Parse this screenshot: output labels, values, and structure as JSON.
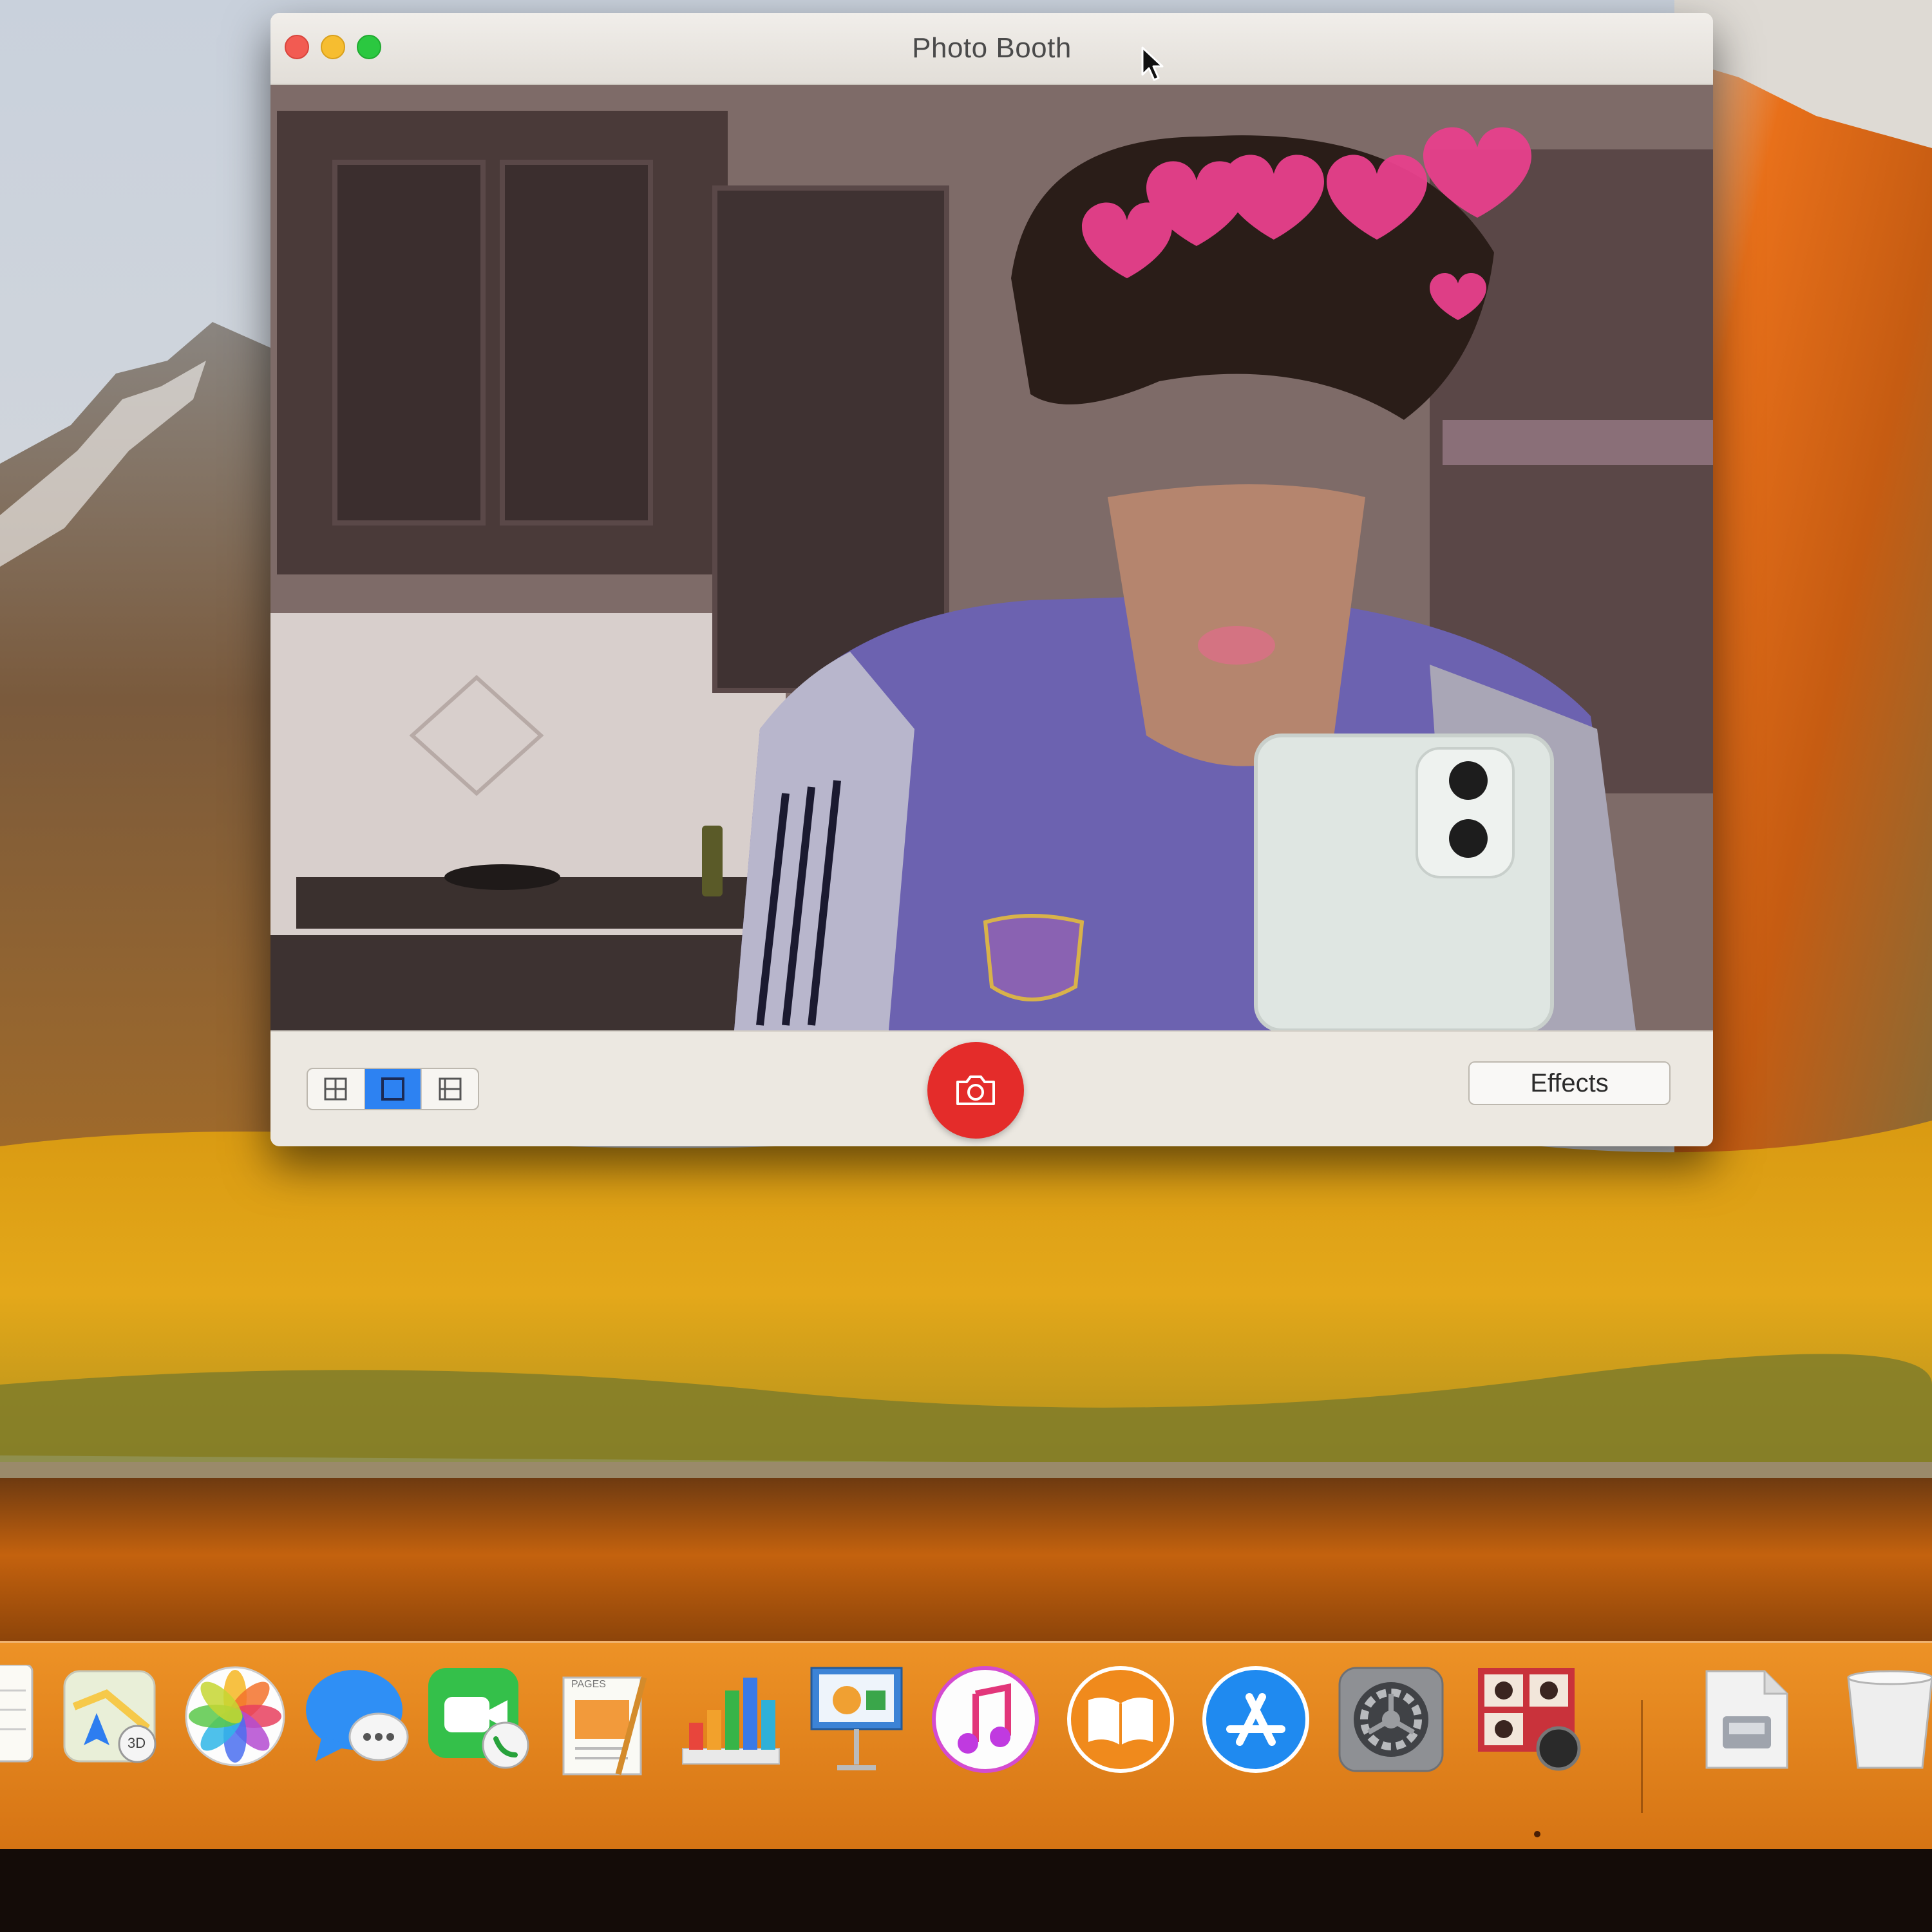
{
  "window": {
    "title": "Photo Booth"
  },
  "toolbar": {
    "layouts": [
      {
        "name": "four-up",
        "icon": "grid-icon",
        "selected": false
      },
      {
        "name": "single",
        "icon": "square-icon",
        "selected": true
      },
      {
        "name": "filmstrip",
        "icon": "filmstrip-icon",
        "selected": false
      }
    ],
    "shutter_icon": "camera-icon",
    "effects_label": "Effects"
  },
  "dock": {
    "items": [
      {
        "name": "Notes",
        "icon": "notes-icon"
      },
      {
        "name": "Maps",
        "icon": "maps-icon",
        "badge": "3D"
      },
      {
        "name": "Photos",
        "icon": "photos-icon"
      },
      {
        "name": "Messages",
        "icon": "messages-icon"
      },
      {
        "name": "FaceTime",
        "icon": "facetime-icon"
      },
      {
        "name": "Pages",
        "icon": "pages-icon",
        "caption": "PAGES"
      },
      {
        "name": "Numbers",
        "icon": "numbers-icon"
      },
      {
        "name": "Keynote",
        "icon": "keynote-icon"
      },
      {
        "name": "iTunes",
        "icon": "music-icon"
      },
      {
        "name": "iBooks",
        "icon": "books-icon"
      },
      {
        "name": "App Store",
        "icon": "app-store-icon"
      },
      {
        "name": "System Preferences",
        "icon": "gear-icon"
      },
      {
        "name": "Photo Booth",
        "icon": "photo-booth-icon",
        "running": true
      },
      {
        "name": "Downloads",
        "icon": "document-icon"
      },
      {
        "name": "Trash",
        "icon": "trash-icon"
      }
    ]
  },
  "colors": {
    "shutter": "#e42c2a",
    "selected_segment": "#2d82f2",
    "dock": "#e5851d",
    "close": "#f25b52",
    "minimize": "#f6bd30",
    "maximize": "#2bc840"
  }
}
